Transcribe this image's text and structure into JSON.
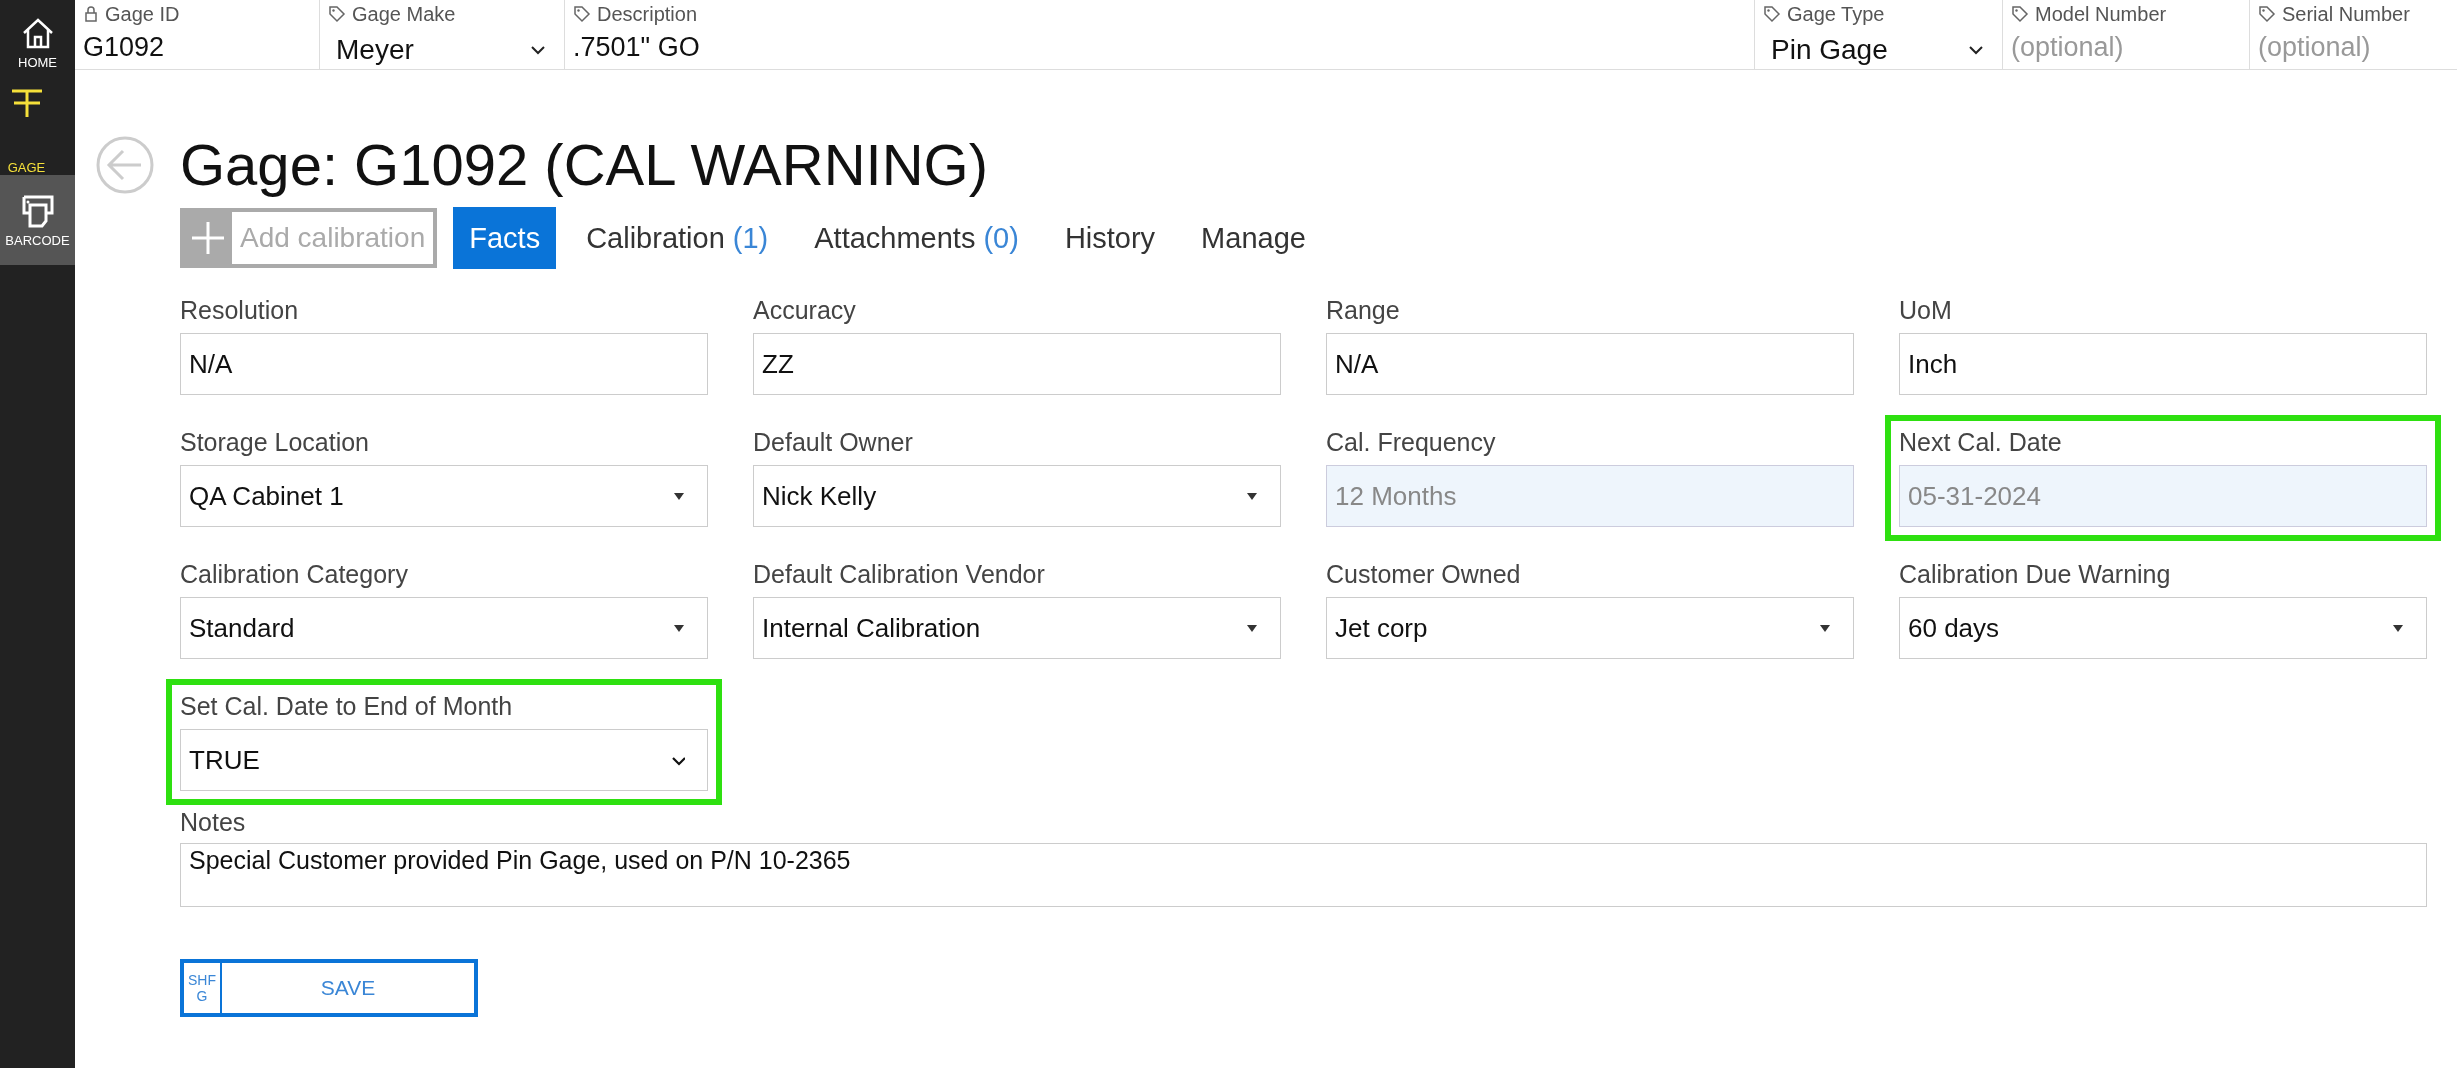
{
  "sidebar": {
    "items": [
      {
        "label": "HOME",
        "selected": false,
        "hovered": false
      },
      {
        "label": "GAGE",
        "selected": true,
        "hovered": false
      },
      {
        "label": "BARCODE",
        "selected": false,
        "hovered": true
      }
    ]
  },
  "header_fields": [
    {
      "label": "Gage ID",
      "locked": true,
      "kind": "text",
      "value": "G1092"
    },
    {
      "label": "Gage Make",
      "locked": false,
      "kind": "select",
      "value": "Meyer"
    },
    {
      "label": "Description",
      "locked": false,
      "kind": "text",
      "value": ".7501\" GO"
    },
    {
      "label": "Gage Type",
      "locked": false,
      "kind": "select",
      "value": "Pin Gage"
    },
    {
      "label": "Model Number",
      "locked": false,
      "kind": "text",
      "placeholder": "(optional)"
    },
    {
      "label": "Serial Number",
      "locked": false,
      "kind": "text",
      "placeholder": "(optional)"
    }
  ],
  "page_title": "Gage: G1092 (CAL WARNING)",
  "add_button": {
    "label": "Add calibration",
    "disabled": true
  },
  "tabs": [
    {
      "label": "Facts",
      "selected": true
    },
    {
      "label": "Calibration",
      "count": "(1)",
      "selected": false
    },
    {
      "label": "Attachments",
      "count": "(0)",
      "selected": false
    },
    {
      "label": "History",
      "selected": false
    },
    {
      "label": "Manage",
      "selected": false
    }
  ],
  "fields": [
    {
      "label": "Resolution",
      "kind": "text",
      "value": "N/A",
      "highlighted": false
    },
    {
      "label": "Accuracy",
      "kind": "text",
      "value": "ZZ",
      "highlighted": false
    },
    {
      "label": "Range",
      "kind": "text",
      "value": "N/A",
      "highlighted": false
    },
    {
      "label": "UoM",
      "kind": "text",
      "value": "Inch",
      "highlighted": false
    },
    {
      "label": "Storage Location",
      "kind": "select",
      "value": "QA Cabinet 1",
      "highlighted": false
    },
    {
      "label": "Default Owner",
      "kind": "select",
      "value": "Nick Kelly",
      "highlighted": false
    },
    {
      "label": "Cal. Frequency",
      "kind": "readonly",
      "value": "12 Months",
      "highlighted": false
    },
    {
      "label": "Next Cal. Date",
      "kind": "readonly",
      "value": "05-31-2024",
      "highlighted": true
    },
    {
      "label": "Calibration Category",
      "kind": "select",
      "value": "Standard",
      "highlighted": false
    },
    {
      "label": "Default Calibration Vendor",
      "kind": "select",
      "value": "Internal Calibration",
      "highlighted": false
    },
    {
      "label": "Customer Owned",
      "kind": "select",
      "value": "Jet corp",
      "highlighted": false
    },
    {
      "label": "Calibration Due Warning",
      "kind": "select",
      "value": "60 days",
      "highlighted": false
    },
    {
      "label": "Set Cal. Date to End of Month",
      "kind": "dropdown",
      "value": "TRUE",
      "highlighted": true
    }
  ],
  "notes": {
    "label": "Notes",
    "value": "Special Customer provided Pin Gage, used on P/N 10-2365"
  },
  "save_button": {
    "shortcut": "SHF G",
    "label": "SAVE"
  }
}
